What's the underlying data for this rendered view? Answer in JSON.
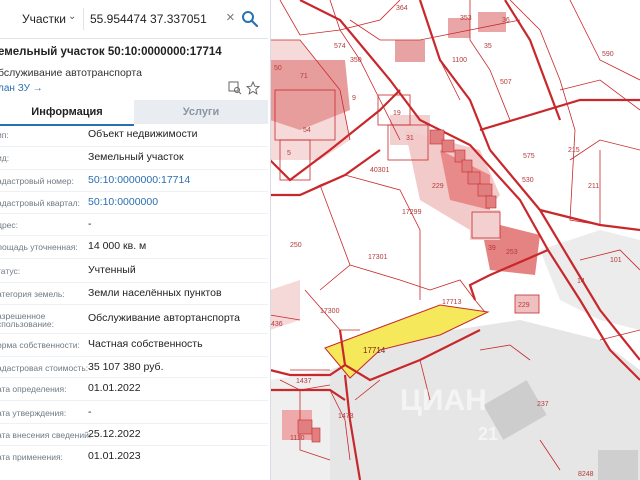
{
  "search": {
    "type_label": "Участки",
    "query": "55.954474 37.337051"
  },
  "parcel": {
    "title": "емельный участок 50:10:0000000:17714",
    "use": "бслуживание автотранспорта",
    "plan_link": "лан ЗУ →"
  },
  "tabs": {
    "info": "Информация",
    "services": "Услуги"
  },
  "details": [
    {
      "label": "ип:",
      "value": "Объект недвижимости"
    },
    {
      "label": "ид:",
      "value": "Земельный участок"
    },
    {
      "label": "адастровый номер:",
      "value": "50:10:0000000:17714"
    },
    {
      "label": "адастровый квартал:",
      "value": "50:10:0000000"
    },
    {
      "label": "дрес:",
      "value": "-"
    },
    {
      "label": "лощадь уточненная:",
      "value": "14 000 кв. м"
    },
    {
      "label": "татус:",
      "value": "Учтенный"
    },
    {
      "label": "атегория земель:",
      "value": "Земли населённых пунктов"
    },
    {
      "label": "азрешенное",
      "label2": "спользование:",
      "value": "Обслуживание автортанспорта"
    },
    {
      "label": "орма собственности:",
      "value": "Частная собственность"
    },
    {
      "label": "адастровая стоимость:",
      "value": "35 107 380 руб."
    },
    {
      "label": "ата определения:",
      "value": "01.01.2022"
    },
    {
      "label": "ата утверждения:",
      "value": "-"
    },
    {
      "label": "ата внесения сведений:",
      "value": "25.12.2022"
    },
    {
      "label": "ата применения:",
      "value": "01.01.2023"
    }
  ],
  "map": {
    "selected_parcel": "17714",
    "labels": {
      "p364": "364",
      "p353": "353",
      "p36": "36",
      "p590": "590",
      "p35": "35",
      "p574": "574",
      "p350": "350",
      "p1100": "1100",
      "p507": "507",
      "p50": "50",
      "p71": "71",
      "p9": "9",
      "p54": "54",
      "p5": "5",
      "p19": "19",
      "p31": "31",
      "p40301": "40301",
      "p575": "575",
      "p215": "215",
      "p530": "530",
      "p211": "211",
      "p229a": "229",
      "p17299": "17299",
      "p39": "39",
      "p253": "253",
      "p250": "250",
      "p17301": "17301",
      "p101": "101",
      "p14": "14",
      "p17713": "17713",
      "p229b": "229",
      "p17300": "17300",
      "p436": "436",
      "p1437": "1437",
      "p237": "237",
      "p1473": "1473",
      "p1110": "1110",
      "p8248": "8248",
      "p574b": "574"
    },
    "watermark": "ЦИАН",
    "watermark_num": "21"
  },
  "colors": {
    "boundary": "#c8282b",
    "parcel_fill": "#f2c8c6",
    "building": "#e08a8a",
    "selected": "#f5e85a",
    "link": "#2a6fb0"
  }
}
